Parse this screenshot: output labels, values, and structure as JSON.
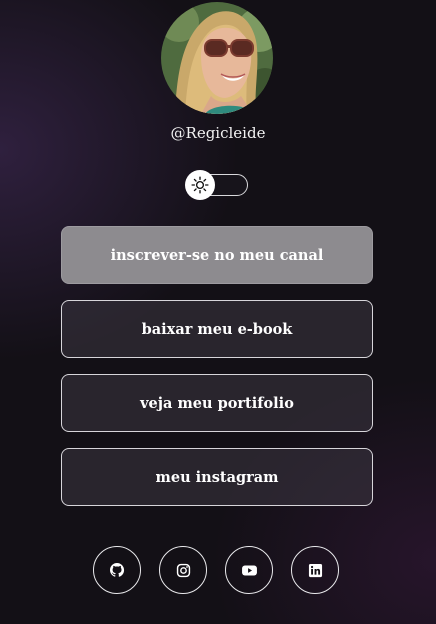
{
  "profile": {
    "username": "@Regicleide",
    "avatar_icon": "profile-photo"
  },
  "theme_toggle": {
    "icon": "sun-icon",
    "mode": "light"
  },
  "links": [
    {
      "label": "inscrever-se no meu canal"
    },
    {
      "label": "baixar meu e-book"
    },
    {
      "label": "veja meu portifolio"
    },
    {
      "label": "meu instagram"
    }
  ],
  "socials": [
    {
      "icon": "github-icon"
    },
    {
      "icon": "instagram-icon"
    },
    {
      "icon": "youtube-icon"
    },
    {
      "icon": "linkedin-icon"
    }
  ],
  "colors": {
    "background": "#131016",
    "active_button": "#8d8b8f",
    "border": "#d7d5da"
  }
}
